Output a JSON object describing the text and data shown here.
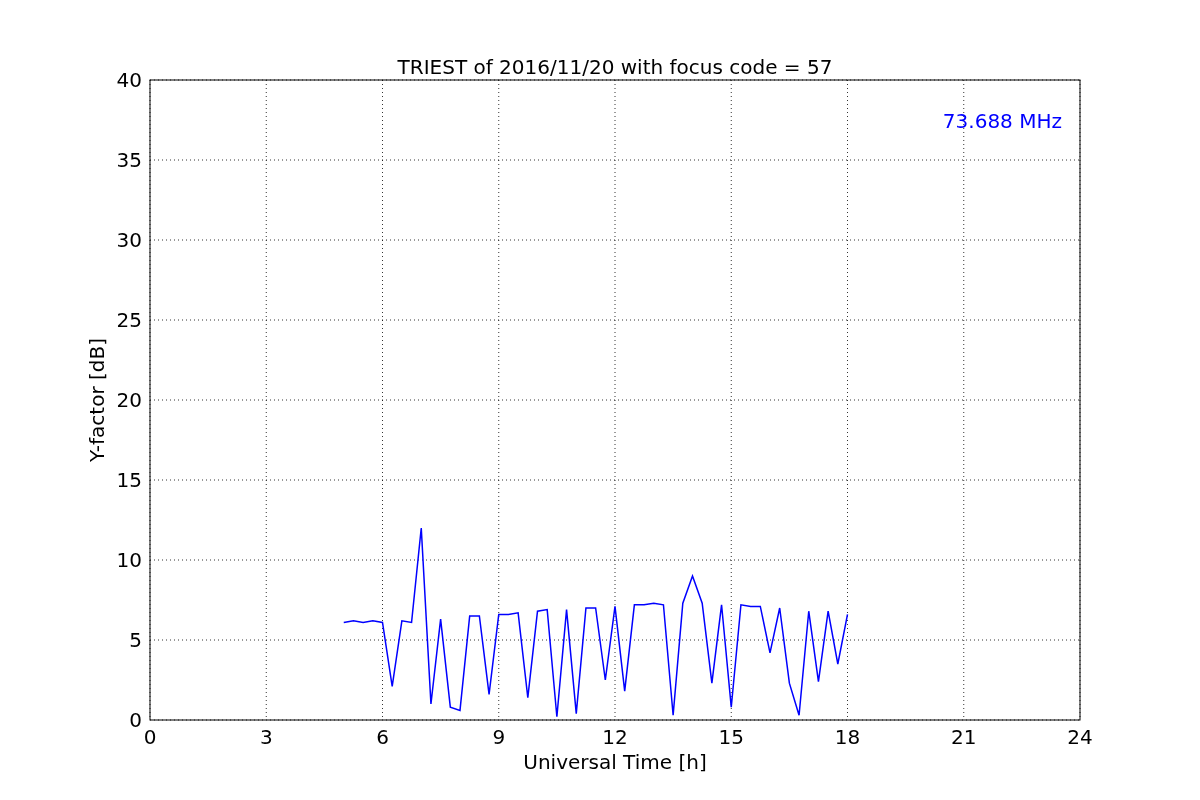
{
  "figure": {
    "chart_data": {
      "type": "line",
      "title": "TRIEST of 2016/11/20 with focus code = 57",
      "xlabel": "Universal Time [h]",
      "ylabel": "Y-factor [dB]",
      "x": [
        5,
        5.25,
        5.5,
        5.75,
        6,
        6.25,
        6.5,
        6.75,
        7,
        7.25,
        7.5,
        7.75,
        8,
        8.25,
        8.5,
        8.75,
        9,
        9.25,
        9.5,
        9.75,
        10,
        10.25,
        10.5,
        10.75,
        11,
        11.25,
        11.5,
        11.75,
        12,
        12.25,
        12.5,
        12.75,
        13,
        13.25,
        13.5,
        13.75,
        14,
        14.25,
        14.5,
        14.75,
        15,
        15.25,
        15.5,
        15.75,
        16,
        16.25,
        16.5,
        16.75,
        17,
        17.25,
        17.5,
        17.75,
        18
      ],
      "series": [
        {
          "name": "73.688 MHz",
          "color": "#0000ff",
          "values": [
            6.1,
            6.2,
            6.1,
            6.2,
            6.1,
            2.1,
            6.2,
            6.1,
            12.0,
            1.0,
            6.3,
            0.8,
            0.6,
            6.5,
            6.5,
            1.6,
            6.6,
            6.6,
            6.7,
            1.4,
            6.8,
            6.9,
            0.2,
            6.9,
            0.4,
            7.0,
            7.0,
            2.5,
            7.1,
            1.8,
            7.2,
            7.2,
            7.3,
            7.2,
            0.3,
            7.3,
            9.0,
            7.3,
            2.3,
            7.2,
            0.8,
            7.2,
            7.1,
            7.1,
            4.2,
            7.0,
            2.3,
            0.3,
            6.8,
            2.4,
            6.8,
            3.5,
            6.6
          ]
        }
      ],
      "xlim": [
        0,
        24
      ],
      "ylim": [
        0,
        40
      ],
      "xticks": [
        0,
        3,
        6,
        9,
        12,
        15,
        18,
        21,
        24
      ],
      "yticks": [
        0,
        5,
        10,
        15,
        20,
        25,
        30,
        35,
        40
      ],
      "grid": true
    }
  }
}
